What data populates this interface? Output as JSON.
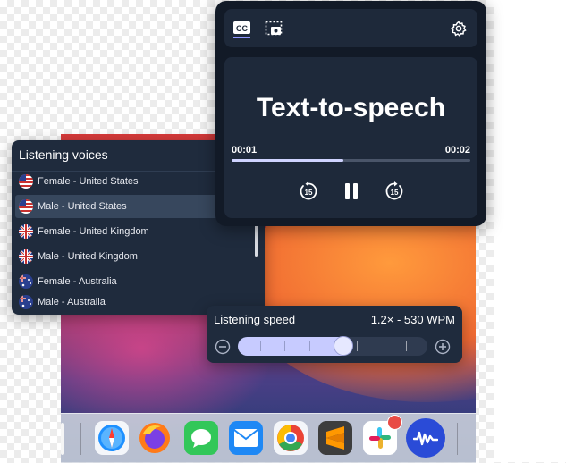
{
  "voices_panel": {
    "title": "Listening voices",
    "items": [
      {
        "label": "Female - United States",
        "flag": "us-flag"
      },
      {
        "label": "Male - United States",
        "flag": "us-flag",
        "selected": true
      },
      {
        "label": "Female - United Kingdom",
        "flag": "uk-flag"
      },
      {
        "label": "Male - United Kingdom",
        "flag": "uk-flag"
      },
      {
        "label": "Female - Australia",
        "flag": "au-flag"
      },
      {
        "label": "Male - Australia",
        "flag": "au-flag"
      }
    ]
  },
  "player": {
    "toolbar": {
      "captions_icon": "closed-captions-icon",
      "screenshot_icon": "screen-capture-icon",
      "settings_icon": "gear-icon"
    },
    "title": "Text-to-speech",
    "elapsed": "00:01",
    "duration": "00:02",
    "progress_fraction": 0.47,
    "controls": {
      "rewind_label": "15",
      "forward_label": "15",
      "pause_icon": "pause-icon"
    }
  },
  "speed_panel": {
    "label": "Listening speed",
    "value": "1.2× - 530 WPM",
    "slider_fraction": 0.55,
    "decrease_icon": "minus-circle-icon",
    "increase_icon": "plus-circle-icon"
  },
  "dock": {
    "apps": [
      "safari-icon",
      "firefox-icon",
      "messages-icon",
      "mail-icon",
      "chrome-icon",
      "sublime-text-icon",
      "slack-icon",
      "speechify-icon"
    ],
    "badge_app": "slack-icon"
  },
  "colors": {
    "panel_bg": "#1f2b3d",
    "player_bg": "#121a27",
    "accent": "#c7cbff",
    "badge_red": "#e84b45"
  }
}
